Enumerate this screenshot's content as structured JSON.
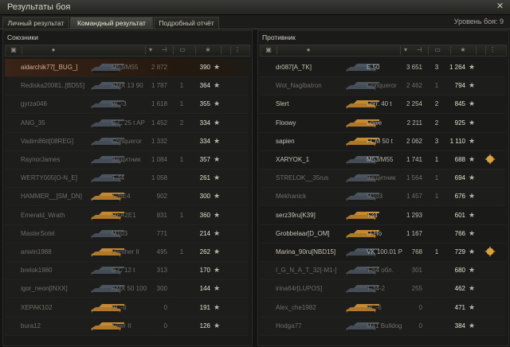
{
  "window": {
    "title": "Результаты боя",
    "close_symbol": "✕"
  },
  "tabs": [
    {
      "label": "Личный результат",
      "active": false
    },
    {
      "label": "Командный результат",
      "active": true
    },
    {
      "label": "Подробный отчёт",
      "active": false
    }
  ],
  "battle_level": "Уровень боя: 9",
  "allies": {
    "title": "Союзники",
    "rows": [
      {
        "name": "aidarchik77[_BUG_]",
        "vehicle": "M53/M55",
        "damage": "2 872",
        "kills": "",
        "xp": "390",
        "alive": false,
        "player": true
      },
      {
        "name": "Rediska20081..[BD55]",
        "vehicle": "AMX 13 90",
        "damage": "1 787",
        "kills": "1",
        "xp": "364",
        "alive": false
      },
      {
        "name": "gyrza046",
        "vehicle": "ИС-3",
        "damage": "1 618",
        "kills": "1",
        "xp": "355",
        "alive": false
      },
      {
        "name": "ANG_35",
        "vehicle": "B-C 25 t AP",
        "damage": "1 452",
        "kills": "2",
        "xp": "334",
        "alive": false
      },
      {
        "name": "Vadim86tt[08REG]",
        "vehicle": "Conqueror",
        "damage": "1 332",
        "kills": "",
        "xp": "334",
        "alive": false
      },
      {
        "name": "RaynorJames",
        "vehicle": "Защитник",
        "damage": "1 084",
        "kills": "1",
        "xp": "357",
        "alive": false
      },
      {
        "name": "WERTY005[O-N_E]",
        "vehicle": "T-44",
        "damage": "1 058",
        "kills": "",
        "xp": "261",
        "alive": false
      },
      {
        "name": "HAMMER__[SM_DN]",
        "vehicle": "T26E4",
        "damage": "902",
        "kills": "",
        "xp": "300",
        "alive": false
      },
      {
        "name": "Emerald_Wrath",
        "vehicle": "M6A2E1",
        "damage": "831",
        "kills": "1",
        "xp": "360",
        "alive": false
      },
      {
        "name": "MasterSotel",
        "vehicle": "M103",
        "damage": "771",
        "kills": "",
        "xp": "214",
        "alive": false
      },
      {
        "name": "anwin1988",
        "vehicle": "Panther II",
        "damage": "495",
        "kills": "1",
        "xp": "262",
        "alive": false
      },
      {
        "name": "brelok1980",
        "vehicle": "B-C 12 t",
        "damage": "313",
        "kills": "",
        "xp": "170",
        "alive": false
      },
      {
        "name": "igor_neon[INXX]",
        "vehicle": "AMX 50 100",
        "damage": "300",
        "kills": "",
        "xp": "144",
        "alive": false
      },
      {
        "name": "XEPAK102",
        "vehicle": "ИС-6",
        "damage": "0",
        "kills": "",
        "xp": "191",
        "alive": false
      },
      {
        "name": "bura12",
        "vehicle": "Tiger II",
        "damage": "0",
        "kills": "",
        "xp": "126",
        "alive": false
      }
    ]
  },
  "enemies": {
    "title": "Противник",
    "rows": [
      {
        "name": "dr087[A_TK]",
        "vehicle": "E 50",
        "damage": "3 651",
        "kills": "3",
        "xp": "1 264",
        "alive": true
      },
      {
        "name": "Wot_Nagibatron",
        "vehicle": "Conqueror",
        "damage": "2 462",
        "kills": "1",
        "xp": "794",
        "alive": false
      },
      {
        "name": "Slert",
        "vehicle": "Lorr. 40 t",
        "damage": "2 254",
        "kills": "2",
        "xp": "845",
        "alive": true
      },
      {
        "name": "Floowy",
        "vehicle": "Löwe",
        "damage": "2 211",
        "kills": "2",
        "xp": "925",
        "alive": true
      },
      {
        "name": "sapien",
        "vehicle": "FCM 50 t",
        "damage": "2 062",
        "kills": "3",
        "xp": "1 110",
        "alive": true
      },
      {
        "name": "XARYOK_1",
        "vehicle": "M53/M55",
        "damage": "1 741",
        "kills": "1",
        "xp": "688",
        "alive": true,
        "medal": true
      },
      {
        "name": "STRELOK__35rus",
        "vehicle": "Защитник",
        "damage": "1 564",
        "kills": "1",
        "xp": "694",
        "alive": false
      },
      {
        "name": "Mekhanick",
        "vehicle": "M103",
        "damage": "1 457",
        "kills": "1",
        "xp": "676",
        "alive": false
      },
      {
        "name": "serz39ru[K39]",
        "vehicle": "T34",
        "damage": "1 293",
        "kills": "",
        "xp": "601",
        "alive": true
      },
      {
        "name": "Grobbelaar[D_OM]",
        "vehicle": "O-Ho",
        "damage": "1 167",
        "kills": "",
        "xp": "766",
        "alive": true
      },
      {
        "name": "Marina_90ru[NBD15]",
        "vehicle": "VK 100.01 P",
        "damage": "768",
        "kills": "1",
        "xp": "729",
        "alive": true,
        "medal": true
      },
      {
        "name": "I_G_N_A_T_32[-M1-]",
        "vehicle": "T-54 обл.",
        "damage": "301",
        "kills": "",
        "xp": "680",
        "alive": false
      },
      {
        "name": "irina64r[LUPOS]",
        "vehicle": "T-34-2",
        "damage": "255",
        "kills": "",
        "xp": "462",
        "alive": false
      },
      {
        "name": "Alex_che1982",
        "vehicle": "ИС-6",
        "damage": "0",
        "kills": "",
        "xp": "471",
        "alive": false
      },
      {
        "name": "Hodga77",
        "vehicle": "M41 Bulldog",
        "damage": "0",
        "kills": "",
        "xp": "384",
        "alive": false
      }
    ]
  },
  "icons": {
    "star": "★",
    "columns": [
      "squad-icon",
      "player-icon",
      "sort-arrow-icon",
      "damage-icon",
      "kills-tank-icon",
      "xp-star-icon",
      "status-icon"
    ]
  },
  "colors": {
    "player_highlight": "#3a2317",
    "medal_gold": "#d9a23a",
    "tank_dark": "#4b5560",
    "tank_gold": "#c9892f"
  }
}
